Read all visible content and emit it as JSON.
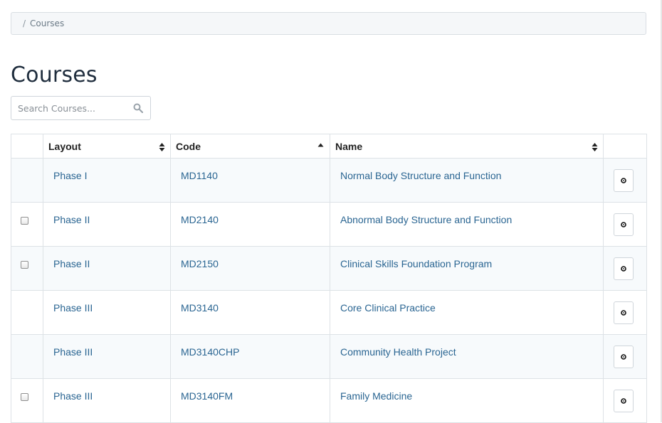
{
  "breadcrumb": {
    "separator": "/",
    "current": "Courses"
  },
  "page": {
    "title": "Courses"
  },
  "search": {
    "placeholder": "Search Courses...",
    "value": "",
    "icon": "search-icon"
  },
  "table": {
    "columns": {
      "layout": "Layout",
      "code": "Code",
      "name": "Name"
    },
    "sort": {
      "column": "code",
      "direction": "ascending"
    },
    "rows": [
      {
        "layout": "Phase I",
        "code": "MD1140",
        "name": "Normal Body Structure and Function",
        "has_checkbox": false,
        "action_icon": "gear-icon"
      },
      {
        "layout": "Phase II",
        "code": "MD2140",
        "name": "Abnormal Body Structure and Function",
        "has_checkbox": true,
        "action_icon": "gear-icon"
      },
      {
        "layout": "Phase II",
        "code": "MD2150",
        "name": "Clinical Skills Foundation Program",
        "has_checkbox": true,
        "action_icon": "gear-icon"
      },
      {
        "layout": "Phase III",
        "code": "MD3140",
        "name": "Core Clinical Practice",
        "has_checkbox": false,
        "action_icon": "gear-icon"
      },
      {
        "layout": "Phase III",
        "code": "MD3140CHP",
        "name": "Community Health Project",
        "has_checkbox": false,
        "action_icon": "gear-icon"
      },
      {
        "layout": "Phase III",
        "code": "MD3140FM",
        "name": "Family Medicine",
        "has_checkbox": true,
        "action_icon": "gear-icon"
      }
    ]
  },
  "colors": {
    "link": "#2a6592",
    "title": "#1f2d3d",
    "row_stripe": "#f7fafc",
    "border": "#dde2e6"
  }
}
